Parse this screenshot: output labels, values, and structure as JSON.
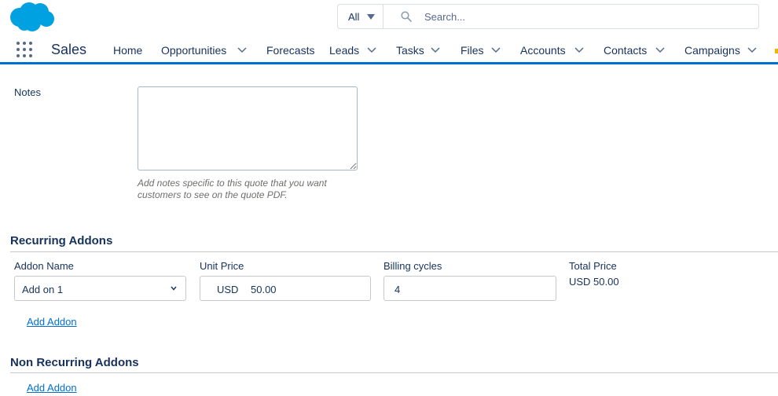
{
  "header": {
    "logo_icon": "salesforce-cloud-logo",
    "brand_color": "#00a1e0",
    "search": {
      "scope": "All",
      "placeholder": "Search..."
    }
  },
  "nav": {
    "app_launcher_icon": "app-launcher-grid-icon",
    "app_name": "Sales",
    "accent_color": "#0070d2",
    "items": [
      {
        "label": "Home",
        "has_dropdown": false
      },
      {
        "label": "Opportunities",
        "has_dropdown": true
      },
      {
        "label": "Forecasts",
        "has_dropdown": false
      },
      {
        "label": "Leads",
        "has_dropdown": true
      },
      {
        "label": "Tasks",
        "has_dropdown": true
      },
      {
        "label": "Files",
        "has_dropdown": true
      },
      {
        "label": "Accounts",
        "has_dropdown": true
      },
      {
        "label": "Contacts",
        "has_dropdown": true
      },
      {
        "label": "Campaigns",
        "has_dropdown": true
      }
    ]
  },
  "notes": {
    "label": "Notes",
    "value": "",
    "help_text": "Add notes specific to this quote that you want customers to see on the quote PDF."
  },
  "recurring_addons": {
    "title": "Recurring Addons",
    "columns": {
      "addon_name": "Addon Name",
      "unit_price": "Unit Price",
      "billing_cycles": "Billing cycles",
      "total_price": "Total Price"
    },
    "rows": [
      {
        "addon_name": "Add on 1",
        "currency": "USD",
        "unit_price": "50.00",
        "billing_cycles": "4",
        "total_price": "USD 50.00"
      }
    ],
    "add_link": "Add Addon"
  },
  "non_recurring_addons": {
    "title": "Non Recurring Addons",
    "add_link": "Add Addon"
  }
}
